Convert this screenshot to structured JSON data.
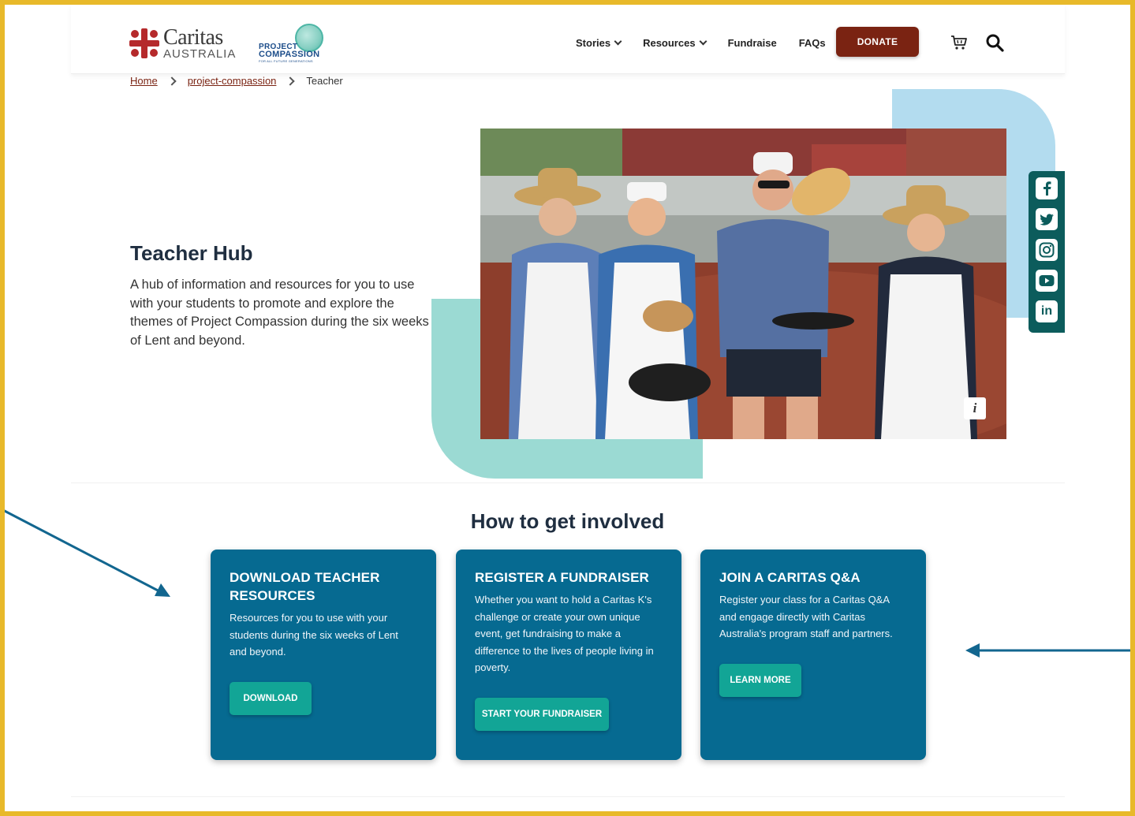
{
  "header": {
    "logo": {
      "name": "Caritas",
      "sub": "AUSTRALIA"
    },
    "project_logo": {
      "line1": "PROJECT",
      "line2": "COMPASSION",
      "tagline": "FOR ALL FUTURE GENERATIONS"
    },
    "nav": [
      {
        "label": "Stories",
        "has_dropdown": true
      },
      {
        "label": "Resources",
        "has_dropdown": true
      },
      {
        "label": "Fundraise",
        "has_dropdown": false
      },
      {
        "label": "FAQs",
        "has_dropdown": false
      }
    ],
    "donate_label": "DONATE",
    "icons": {
      "cart": "cart-icon",
      "search": "search-icon"
    }
  },
  "breadcrumb": {
    "items": [
      {
        "label": "Home",
        "link": true
      },
      {
        "label": "project-compassion",
        "link": true
      },
      {
        "label": "Teacher",
        "link": false
      }
    ]
  },
  "hero": {
    "title": "Teacher Hub",
    "description": "A hub of information and resources for you to use with your students to promote and explore the themes of Project Compassion during the six weeks of Lent and beyond.",
    "info_label": "i"
  },
  "social": {
    "items": [
      {
        "icon": "facebook-icon",
        "glyph": "f"
      },
      {
        "icon": "twitter-icon",
        "glyph": "t"
      },
      {
        "icon": "instagram-icon",
        "glyph": "ig"
      },
      {
        "icon": "youtube-icon",
        "glyph": "yt"
      },
      {
        "icon": "linkedin-icon",
        "glyph": "in"
      }
    ]
  },
  "involved": {
    "title": "How to get involved",
    "cards": [
      {
        "heading": "DOWNLOAD TEACHER RESOURCES",
        "text": "Resources for you to use with your students during the six weeks of Lent and beyond.",
        "button": "DOWNLOAD"
      },
      {
        "heading": "REGISTER A FUNDRAISER",
        "text": "Whether you want to hold a Caritas K's challenge or create your own unique event, get fundraising to make a difference to the lives of people living in poverty.",
        "button": "START YOUR FUNDRAISER"
      },
      {
        "heading": "JOIN A CARITAS Q&A",
        "text": "Register your class for a Caritas Q&A and engage directly with Caritas Australia's program staff and partners.",
        "button": "LEARN MORE"
      }
    ]
  },
  "colors": {
    "frame": "#e8b92a",
    "donate": "#7a2312",
    "card": "#066a91",
    "button": "#12a596",
    "social": "#0c5c5c",
    "arrow": "#12668f"
  }
}
